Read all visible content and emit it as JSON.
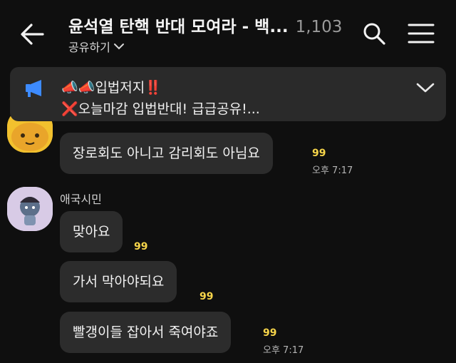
{
  "header": {
    "title": "윤석열 탄핵 반대 모여라 - 백...",
    "member_count": "1,103",
    "share_label": "공유하기"
  },
  "notice": {
    "line1": "📣📣입법저지‼️",
    "line2": "❌오늘마감 입법반대! 급급공유!..."
  },
  "messages": [
    {
      "text": "장로회도 아니고 감리회도 아님요",
      "read": "99",
      "time": "오후 7:17"
    },
    {
      "text": "맞아요",
      "read": "99"
    },
    {
      "text": "가서 막아야되요",
      "read": "99"
    },
    {
      "text": "빨갱이들 잡아서 죽여야죠",
      "read": "99",
      "time": "오후 7:17"
    }
  ],
  "sender2": {
    "name": "애국시민"
  },
  "icons": [
    "back-arrow-icon",
    "chevron-down-icon",
    "search-icon",
    "menu-icon",
    "megaphone-icon",
    "chevron-down-icon"
  ]
}
